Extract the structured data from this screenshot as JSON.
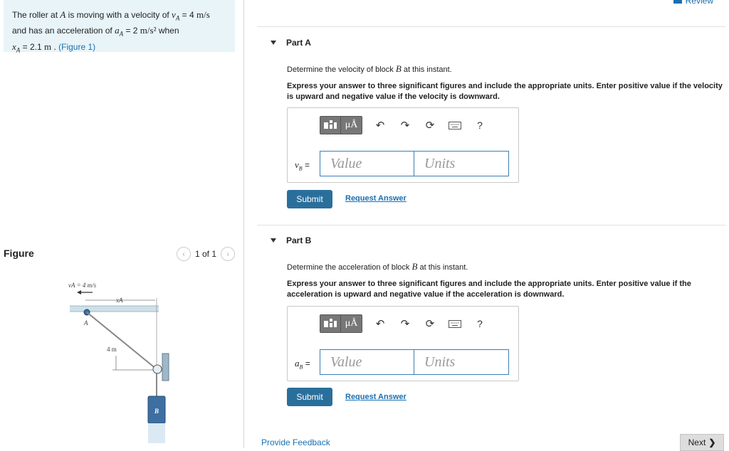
{
  "problem": {
    "prefix": "The roller at ",
    "A": "A",
    "mid1": " is moving with a velocity of ",
    "vA_sym": "v",
    "vA_sub": "A",
    "eq1": " = 4 ",
    "vA_unit": "m/s",
    "mid2": "and has an acceleration of ",
    "aA_sym": "a",
    "aA_sub": "A",
    "eq2": " = 2 ",
    "aA_unit": "m/s²",
    "when": " when",
    "xA_sym": "x",
    "xA_sub": "A",
    "eq3": " = 2.1 ",
    "xA_unit": "m",
    "dot": " . ",
    "figure_link": "(Figure 1)"
  },
  "figure": {
    "title": "Figure",
    "pager": "1 of 1",
    "prev_icon": "chevron-left-icon",
    "next_icon": "chevron-right-icon",
    "label_v": "vA = 4 m/s",
    "label_x": "xA",
    "label_A": "A",
    "label_4m": "4 m",
    "label_B": "B"
  },
  "header": {
    "review": "Review"
  },
  "partA": {
    "title": "Part A",
    "q_pre": "Determine the velocity of block ",
    "q_var": "B",
    "q_post": " at this instant.",
    "instructions": "Express your answer to three significant figures and include the appropriate units. Enter positive value if the velocity is upward and negative value if the velocity is downward.",
    "var_sym": "v",
    "var_sub": "B",
    "var_eq": " =",
    "value_placeholder": "Value",
    "units_placeholder": "Units",
    "submit": "Submit",
    "request": "Request Answer"
  },
  "partB": {
    "title": "Part B",
    "q_pre": "Determine the acceleration of block ",
    "q_var": "B",
    "q_post": " at this instant.",
    "instructions": "Express your answer to three significant figures and include the appropriate units. Enter positive value if the acceleration is upward and negative value if the acceleration is downward.",
    "var_sym": "a",
    "var_sub": "B",
    "var_eq": " =",
    "value_placeholder": "Value",
    "units_placeholder": "Units",
    "submit": "Submit",
    "request": "Request Answer"
  },
  "toolbar": {
    "mu": "μÅ",
    "help": "?",
    "icons": [
      "templates-icon",
      "units-icon",
      "undo-icon",
      "redo-icon",
      "reset-icon",
      "keyboard-icon",
      "help-icon"
    ]
  },
  "footer": {
    "feedback": "Provide Feedback",
    "next": "Next"
  }
}
